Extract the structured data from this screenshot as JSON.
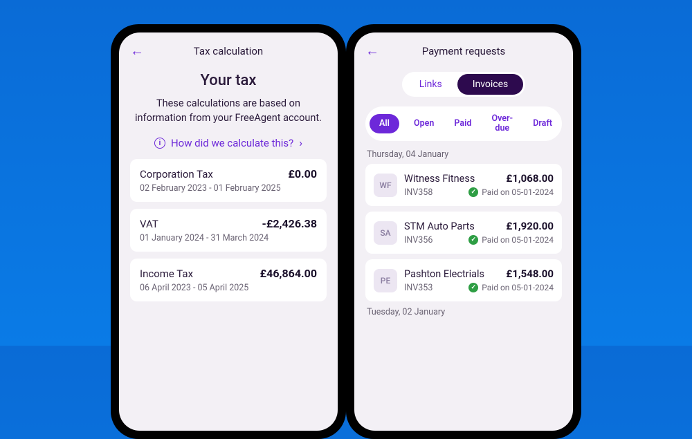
{
  "left": {
    "header_title": "Tax calculation",
    "title": "Your tax",
    "subtitle": "These calculations are based on information from your FreeAgent account.",
    "calc_link": "How did we calculate this?",
    "items": [
      {
        "label": "Corporation Tax",
        "amount": "£0.00",
        "period": "02 February 2023 - 01 February 2025"
      },
      {
        "label": "VAT",
        "amount": "-£2,426.38",
        "period": "01 January 2024 - 31 March 2024"
      },
      {
        "label": "Income Tax",
        "amount": "£46,864.00",
        "period": "06 April 2023 - 05 April 2025"
      }
    ]
  },
  "right": {
    "header_title": "Payment requests",
    "toggle": {
      "links": "Links",
      "invoices": "Invoices"
    },
    "filters": {
      "all": "All",
      "open": "Open",
      "paid": "Paid",
      "overdue_l1": "Over-",
      "overdue_l2": "due",
      "draft": "Draft"
    },
    "group1_date": "Thursday, 04 January",
    "inv": [
      {
        "initials": "WF",
        "name": "Witness Fitness",
        "amount": "£1,068.00",
        "ref": "INV358",
        "status": "Paid on 05-01-2024"
      },
      {
        "initials": "SA",
        "name": "STM Auto Parts",
        "amount": "£1,920.00",
        "ref": "INV356",
        "status": "Paid on 05-01-2024"
      },
      {
        "initials": "PE",
        "name": "Pashton Electrials",
        "amount": "£1,548.00",
        "ref": "INV353",
        "status": "Paid on 05-01-2024"
      }
    ],
    "group2_date": "Tuesday, 02 January"
  }
}
